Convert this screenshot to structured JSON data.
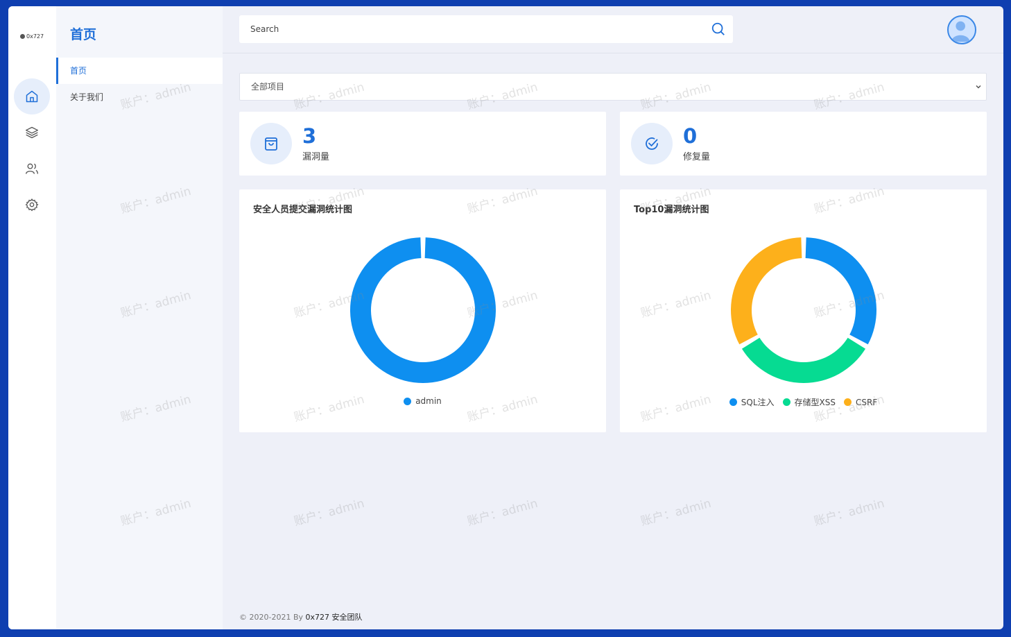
{
  "logo": {
    "text": "0x727"
  },
  "rail": {
    "items": [
      "home-icon",
      "layers-icon",
      "users-icon",
      "gear-icon"
    ]
  },
  "menu": {
    "title": "首页",
    "items": [
      {
        "label": "首页"
      },
      {
        "label": "关于我们"
      }
    ]
  },
  "search": {
    "placeholder": "Search"
  },
  "project_select": {
    "value": "全部项目"
  },
  "stats": [
    {
      "value": "3",
      "label": "漏洞量",
      "icon": "bag-icon"
    },
    {
      "value": "0",
      "label": "修复量",
      "icon": "check-circle-icon"
    }
  ],
  "chart_data": [
    {
      "type": "pie",
      "title": "安全人员提交漏洞统计图",
      "categories": [
        "admin"
      ],
      "values": [
        3
      ],
      "colors": [
        "#0e8ff0"
      ],
      "legend": "bottom"
    },
    {
      "type": "pie",
      "title": "Top10漏洞统计图",
      "categories": [
        "SQL注入",
        "存储型XSS",
        "CSRF"
      ],
      "values": [
        1,
        1,
        1
      ],
      "colors": [
        "#0e8ff0",
        "#06db92",
        "#fdb01b"
      ],
      "legend": "bottom"
    }
  ],
  "footer": {
    "copyright": "© 2020-2021 By ",
    "brand": "0x727 安全团队"
  },
  "watermark": {
    "text": "账户：admin"
  },
  "colors": {
    "accent": "#1f6fd8",
    "frame": "#0f3fb0",
    "background": "#eef0f8"
  }
}
